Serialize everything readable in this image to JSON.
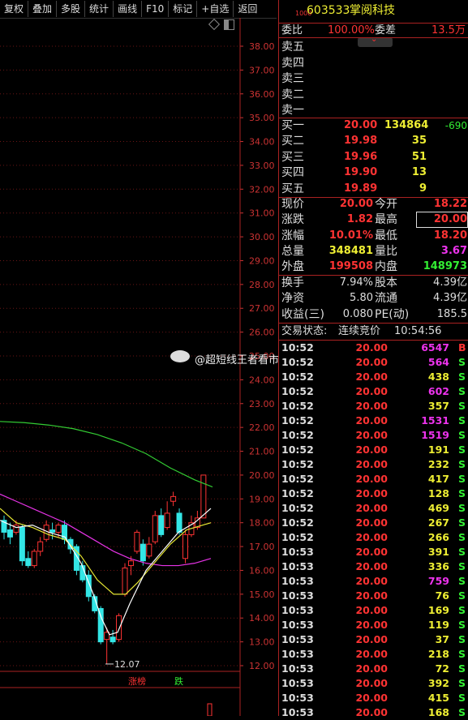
{
  "toolbar": [
    "复权",
    "叠加",
    "多股",
    "统计",
    "画线",
    "F10",
    "标记",
    "+自选",
    "返回"
  ],
  "chart": {
    "price_ticks": [
      "38.00",
      "37.00",
      "36.00",
      "35.00",
      "34.00",
      "33.00",
      "32.00",
      "31.00",
      "30.00",
      "29.00",
      "28.00",
      "27.00",
      "26.00",
      "25.00",
      "24.00",
      "23.00",
      "22.00",
      "21.00",
      "20.00",
      "19.00",
      "18.00",
      "17.00",
      "16.00",
      "15.00",
      "14.00",
      "13.00",
      "12.00"
    ],
    "low_marker": "12.07",
    "watermark": "@超短线王者看市",
    "bottom_tags": [
      "涨榜",
      "跌"
    ],
    "colors": {
      "up": "#ff3333",
      "down": "#33e6e6",
      "ma_white": "#ffffff",
      "ma_yellow": "#e6e633",
      "ma_magenta": "#e633e6",
      "ma_green": "#33cc33"
    }
  },
  "stock": {
    "code_small": "1000",
    "code": "603533",
    "name": "掌阅科技"
  },
  "ratio": {
    "label_wb": "委比",
    "wb": "100.00%",
    "label_wc": "委差",
    "wc": "13.5万"
  },
  "sells": [
    {
      "label": "卖五"
    },
    {
      "label": "卖四"
    },
    {
      "label": "卖三"
    },
    {
      "label": "卖二"
    },
    {
      "label": "卖一"
    }
  ],
  "buys": [
    {
      "label": "买一",
      "price": "20.00",
      "vol": "134864",
      "chg": "-690"
    },
    {
      "label": "买二",
      "price": "19.98",
      "vol": "35",
      "chg": ""
    },
    {
      "label": "买三",
      "price": "19.96",
      "vol": "51",
      "chg": ""
    },
    {
      "label": "买四",
      "price": "19.90",
      "vol": "13",
      "chg": ""
    },
    {
      "label": "买五",
      "price": "19.89",
      "vol": "9",
      "chg": ""
    }
  ],
  "quote": {
    "xj_l": "现价",
    "xj": "20.00",
    "jk_l": "今开",
    "jk": "18.22",
    "zd_l": "涨跌",
    "zd": "1.82",
    "zg_l": "最高",
    "zg": "20.00",
    "zf_l": "涨幅",
    "zf": "10.01%",
    "zd2_l": "最低",
    "zd2": "18.20",
    "zl_l": "总量",
    "zl": "348481",
    "lb_l": "量比",
    "lb": "3.67",
    "wp_l": "外盘",
    "wp": "199508",
    "np_l": "内盘",
    "np": "148973"
  },
  "fund": {
    "hs_l": "换手",
    "hs": "7.94%",
    "gb_l": "股本",
    "gb": "4.39亿",
    "jz_l": "净资",
    "jz": "5.80",
    "lt_l": "流通",
    "lt": "4.39亿",
    "sy_l": "收益(三)",
    "sy": "0.080",
    "pe_l": "PE(动)",
    "pe": "185.5"
  },
  "status": {
    "label": "交易状态:",
    "value": "连续竞价",
    "time": "10:54:56"
  },
  "ticks": [
    {
      "t": "10:52",
      "p": "20.00",
      "v": "6547",
      "bs": "B",
      "c": "mag"
    },
    {
      "t": "10:52",
      "p": "20.00",
      "v": "564",
      "bs": "S",
      "c": "mag"
    },
    {
      "t": "10:52",
      "p": "20.00",
      "v": "438",
      "bs": "S",
      "c": "yel"
    },
    {
      "t": "10:52",
      "p": "20.00",
      "v": "602",
      "bs": "S",
      "c": "mag"
    },
    {
      "t": "10:52",
      "p": "20.00",
      "v": "357",
      "bs": "S",
      "c": "yel"
    },
    {
      "t": "10:52",
      "p": "20.00",
      "v": "1531",
      "bs": "S",
      "c": "mag"
    },
    {
      "t": "10:52",
      "p": "20.00",
      "v": "1519",
      "bs": "S",
      "c": "mag"
    },
    {
      "t": "10:52",
      "p": "20.00",
      "v": "191",
      "bs": "S",
      "c": "yel"
    },
    {
      "t": "10:52",
      "p": "20.00",
      "v": "232",
      "bs": "S",
      "c": "yel"
    },
    {
      "t": "10:52",
      "p": "20.00",
      "v": "417",
      "bs": "S",
      "c": "yel"
    },
    {
      "t": "10:52",
      "p": "20.00",
      "v": "128",
      "bs": "S",
      "c": "yel"
    },
    {
      "t": "10:52",
      "p": "20.00",
      "v": "469",
      "bs": "S",
      "c": "yel"
    },
    {
      "t": "10:52",
      "p": "20.00",
      "v": "267",
      "bs": "S",
      "c": "yel"
    },
    {
      "t": "10:52",
      "p": "20.00",
      "v": "266",
      "bs": "S",
      "c": "yel"
    },
    {
      "t": "10:53",
      "p": "20.00",
      "v": "391",
      "bs": "S",
      "c": "yel"
    },
    {
      "t": "10:53",
      "p": "20.00",
      "v": "336",
      "bs": "S",
      "c": "yel"
    },
    {
      "t": "10:53",
      "p": "20.00",
      "v": "759",
      "bs": "S",
      "c": "mag"
    },
    {
      "t": "10:53",
      "p": "20.00",
      "v": "76",
      "bs": "S",
      "c": "yel"
    },
    {
      "t": "10:53",
      "p": "20.00",
      "v": "169",
      "bs": "S",
      "c": "yel"
    },
    {
      "t": "10:53",
      "p": "20.00",
      "v": "119",
      "bs": "S",
      "c": "yel"
    },
    {
      "t": "10:53",
      "p": "20.00",
      "v": "37",
      "bs": "S",
      "c": "yel"
    },
    {
      "t": "10:53",
      "p": "20.00",
      "v": "218",
      "bs": "S",
      "c": "yel"
    },
    {
      "t": "10:53",
      "p": "20.00",
      "v": "72",
      "bs": "S",
      "c": "yel"
    },
    {
      "t": "10:53",
      "p": "20.00",
      "v": "392",
      "bs": "S",
      "c": "yel"
    },
    {
      "t": "10:53",
      "p": "20.00",
      "v": "415",
      "bs": "S",
      "c": "yel"
    },
    {
      "t": "10:53",
      "p": "20.00",
      "v": "168",
      "bs": "S",
      "c": "yel"
    }
  ]
}
